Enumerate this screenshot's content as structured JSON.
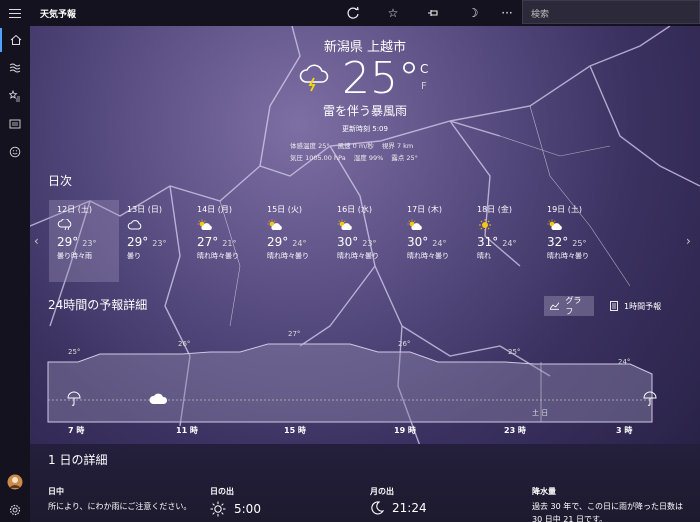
{
  "app": {
    "title": "天気予報",
    "search_placeholder": "検索"
  },
  "current": {
    "location": "新潟県 上越市",
    "temp": "25°",
    "unit_c": "C",
    "unit_f": "F",
    "condition": "雷を伴う暴風雨",
    "updated": "更新時刻 5:09",
    "details_row1": [
      "体感温度  25°",
      "風速  0 m/秒",
      "視界  7 km"
    ],
    "details_row2": [
      "気圧  1005.00 hPa",
      "湿度  99%",
      "露点  25°"
    ]
  },
  "daily": {
    "title": "日次",
    "days": [
      {
        "date": "12日 (土)",
        "hi": "29°",
        "lo": "23°",
        "cap": "曇り時々雨",
        "icon": "cloud-rain"
      },
      {
        "date": "13日 (日)",
        "hi": "29°",
        "lo": "23°",
        "cap": "曇り",
        "icon": "cloud"
      },
      {
        "date": "14日 (月)",
        "hi": "27°",
        "lo": "21°",
        "cap": "晴れ時々曇り",
        "icon": "sun-cloud"
      },
      {
        "date": "15日 (火)",
        "hi": "29°",
        "lo": "24°",
        "cap": "晴れ時々曇り",
        "icon": "sun-cloud"
      },
      {
        "date": "16日 (水)",
        "hi": "30°",
        "lo": "23°",
        "cap": "晴れ時々曇り",
        "icon": "sun-cloud"
      },
      {
        "date": "17日 (木)",
        "hi": "30°",
        "lo": "24°",
        "cap": "晴れ時々曇り",
        "icon": "sun-cloud"
      },
      {
        "date": "18日 (金)",
        "hi": "31°",
        "lo": "24°",
        "cap": "晴れ",
        "icon": "sun"
      },
      {
        "date": "19日 (土)",
        "hi": "32°",
        "lo": "25°",
        "cap": "晴れ時々曇り",
        "icon": "sun-cloud"
      }
    ]
  },
  "hourly": {
    "title": "24時間の予報詳細",
    "graph_label": "グラフ",
    "hourly_label": "1時間予報",
    "temps": [
      "25°",
      "26°",
      "27°",
      "26°",
      "25°",
      "24°"
    ],
    "times": [
      "7 時",
      "11 時",
      "15 時",
      "19 時",
      "23 時",
      "3 時"
    ],
    "day_marker": "土 日"
  },
  "day_details": {
    "title": "1 日の詳細",
    "summary_h": "日中",
    "summary_v": "所により、にわか雨にご注意ください。",
    "sunrise_h": "日の出",
    "sunrise_v": "5:00",
    "moonrise_h": "月の出",
    "moonrise_v": "21:24",
    "precip_h": "降水量",
    "precip_v1": "過去 30 年で、この日に雨が降った日数は",
    "precip_v2": "30 日中 21 日です。"
  }
}
